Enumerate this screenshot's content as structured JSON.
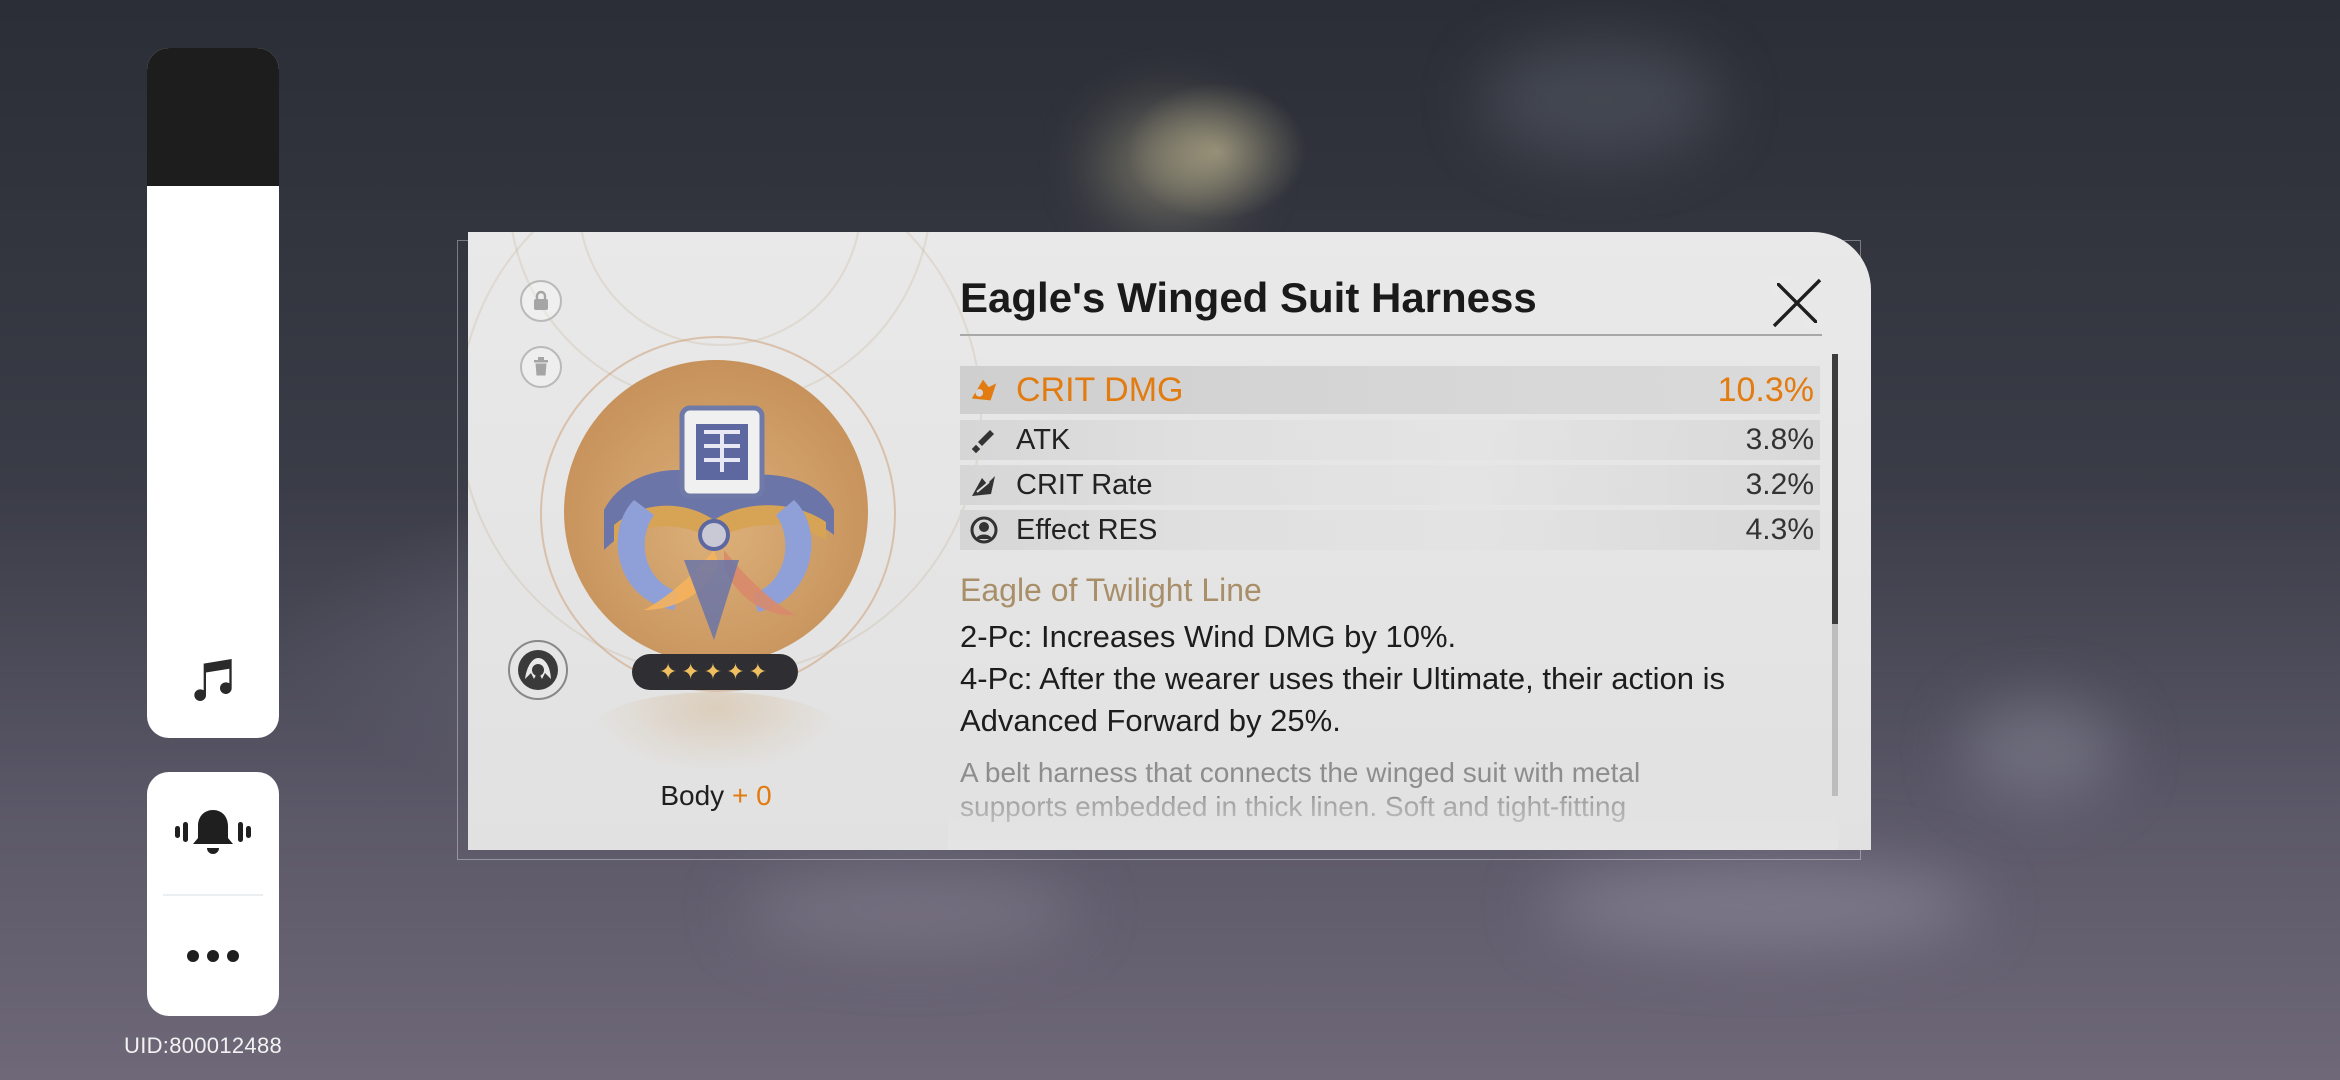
{
  "sidebar": {
    "volume_level": 0.8,
    "music_icon": "music-note-icon",
    "bell_icon": "bell-ringing-icon",
    "more_icon": "more-dots-icon",
    "uid_text": "UID:800012488"
  },
  "relic": {
    "title": "Eagle's Winged Suit Harness",
    "stars": "✦✦✦✦✦",
    "rarity": 5,
    "slot_label": "Body",
    "level_text": "+ 0",
    "lock_icon": "lock-icon",
    "trash_icon": "trash-icon",
    "character_icon": "character-portrait-icon",
    "close_icon": "close-icon"
  },
  "stats": {
    "main": {
      "name": "CRIT DMG",
      "value": "10.3%",
      "icon": "crit-dmg-icon"
    },
    "subs": [
      {
        "name": "ATK",
        "value": "3.8%",
        "icon": "atk-icon"
      },
      {
        "name": "CRIT Rate",
        "value": "3.2%",
        "icon": "crit-rate-icon"
      },
      {
        "name": "Effect RES",
        "value": "4.3%",
        "icon": "effect-res-icon"
      }
    ]
  },
  "set": {
    "name": "Eagle of Twilight Line",
    "effect_2pc": "2-Pc: Increases Wind DMG by 10%.",
    "effect_4pc_line1": "4-Pc: After the wearer uses their Ultimate, their action is",
    "effect_4pc_line2": "Advanced Forward by 25%.",
    "lore_line1": "A belt harness that connects the winged suit with metal",
    "lore_line2": "supports embedded in thick linen. Soft and tight-fitting"
  },
  "colors": {
    "accent_orange": "#e27b10",
    "set_name_gold": "#a88f6a"
  }
}
